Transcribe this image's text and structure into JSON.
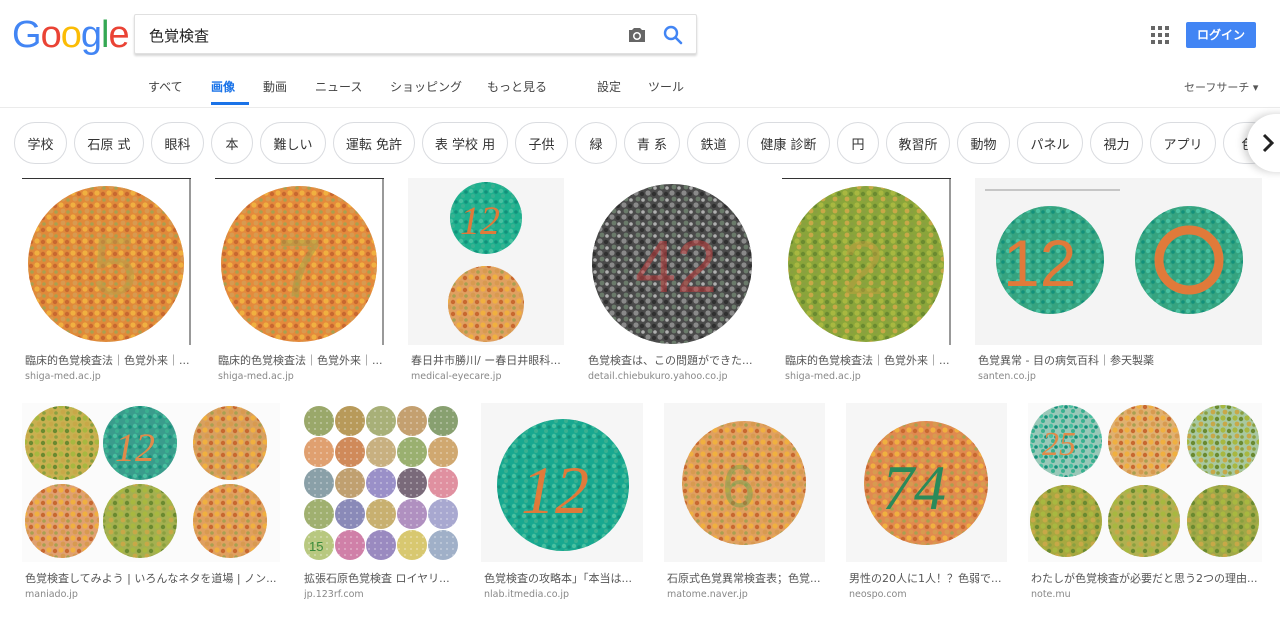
{
  "logo": {
    "letters": [
      "G",
      "o",
      "o",
      "g",
      "l",
      "e"
    ],
    "colors": [
      "#4285f4",
      "#ea4335",
      "#fbbc05",
      "#4285f4",
      "#34a853",
      "#ea4335"
    ]
  },
  "search": {
    "query": "色覚検査"
  },
  "header": {
    "login_label": "ログイン",
    "safesearch_label": "セーフサーチ ▾"
  },
  "nav": {
    "tabs": [
      "すべて",
      "画像",
      "動画",
      "ニュース",
      "ショッピング",
      "もっと見る",
      "設定",
      "ツール"
    ],
    "active": "画像"
  },
  "chips": [
    "学校",
    "石原 式",
    "眼科",
    "本",
    "難しい",
    "運転 免許",
    "表 学校 用",
    "子供",
    "緑",
    "青 系",
    "鉄道",
    "健康 診断",
    "円",
    "教習所",
    "動物",
    "パネル",
    "視力",
    "アプリ",
    "色"
  ],
  "results_row1": [
    {
      "caption": "臨床的色覚検査法｜色覚外来｜...",
      "source": "shiga-med.ac.jp",
      "plate_number": "5"
    },
    {
      "caption": "臨床的色覚検査法｜色覚外来｜...",
      "source": "shiga-med.ac.jp",
      "plate_number": "7"
    },
    {
      "caption": "春日井市勝川/ ー春日井眼科...",
      "source": "medical-eyecare.jp",
      "plate_number": "12"
    },
    {
      "caption": "色覚検査は、この問題ができた...",
      "source": "detail.chiebukuro.yahoo.co.jp",
      "plate_number": "42"
    },
    {
      "caption": "臨床的色覚検査法｜色覚外来｜...",
      "source": "shiga-med.ac.jp",
      "plate_number": "2"
    },
    {
      "caption": "色覚異常 - 目の病気百科｜参天製薬",
      "source": "santen.co.jp",
      "plate_number": "12"
    }
  ],
  "results_row2": [
    {
      "caption": "色覚検査してみよう | いろんなネタを道場 | ノン...",
      "source": "maniado.jp",
      "plate_number": "12"
    },
    {
      "caption": "拡張石原色覚検査 ロイヤリ...",
      "source": "jp.123rf.com",
      "plate_number": "15"
    },
    {
      "caption": "色覚検査の攻略本」「本当は...",
      "source": "nlab.itmedia.co.jp",
      "plate_number": "12"
    },
    {
      "caption": "石原式色覚異常検査表；色覚...",
      "source": "matome.naver.jp",
      "plate_number": "6"
    },
    {
      "caption": "男性の20人に1人！？色弱で...",
      "source": "neospo.com",
      "plate_number": "74"
    },
    {
      "caption": "わたしが色覚検査が必要だと思う2つの理由...",
      "source": "note.mu",
      "plate_number": "25"
    }
  ],
  "colors": {
    "accent": "#1a73e8",
    "login_bg": "#4285f4"
  }
}
